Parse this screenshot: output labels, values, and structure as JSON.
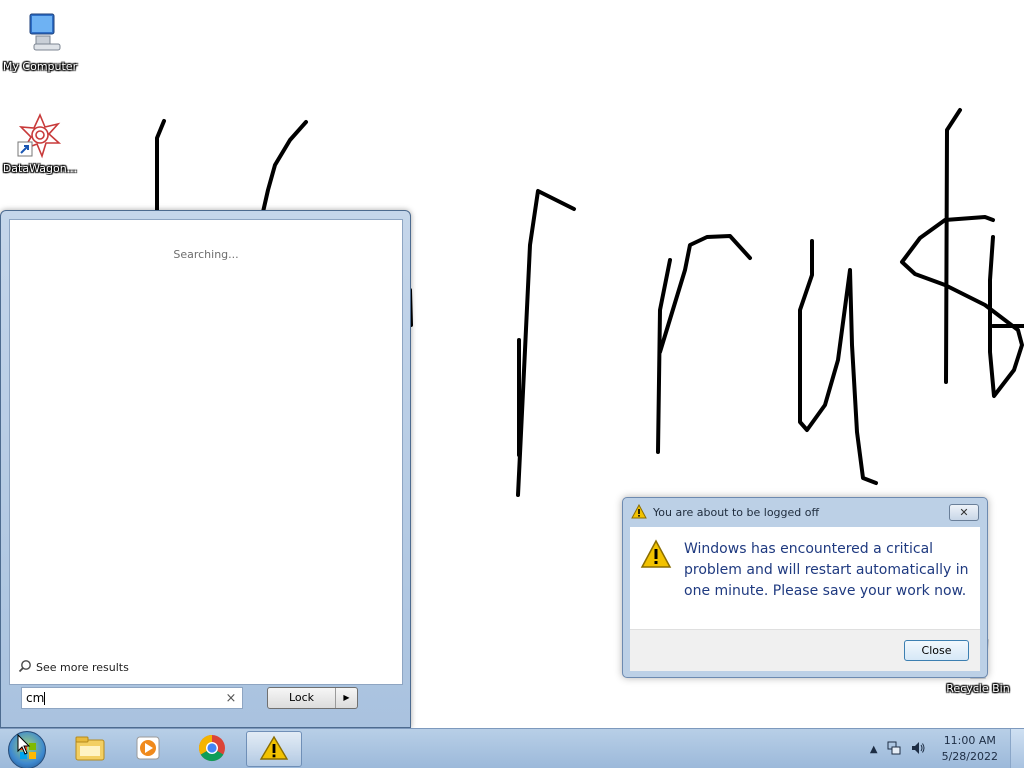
{
  "desktop": {
    "icons": [
      {
        "label": "My Computer"
      },
      {
        "label": "DataWagon..."
      },
      {
        "label": "Recycle Bin"
      }
    ]
  },
  "start_menu": {
    "status": "Searching...",
    "see_more": "See more results",
    "search_value": "cm",
    "clear_glyph": "×",
    "power_button": "Lock",
    "power_arrow": "▶"
  },
  "dialog": {
    "title": "You are about to be logged off",
    "close_glyph": "✕",
    "message": "Windows has encountered a critical problem and will restart automatically in one minute. Please save your work now.",
    "close_button": "Close"
  },
  "taskbar": {
    "apps": [
      {
        "icon": "explorer-icon"
      },
      {
        "icon": "media-player-icon"
      },
      {
        "icon": "chrome-icon"
      },
      {
        "icon": "warning-icon"
      }
    ],
    "tray_arrow": "▲",
    "clock_time": "11:00 AM",
    "clock_date": "5/28/2022"
  },
  "colors": {
    "dialog_message": "#1f3a80",
    "warning": "#f2c200"
  }
}
